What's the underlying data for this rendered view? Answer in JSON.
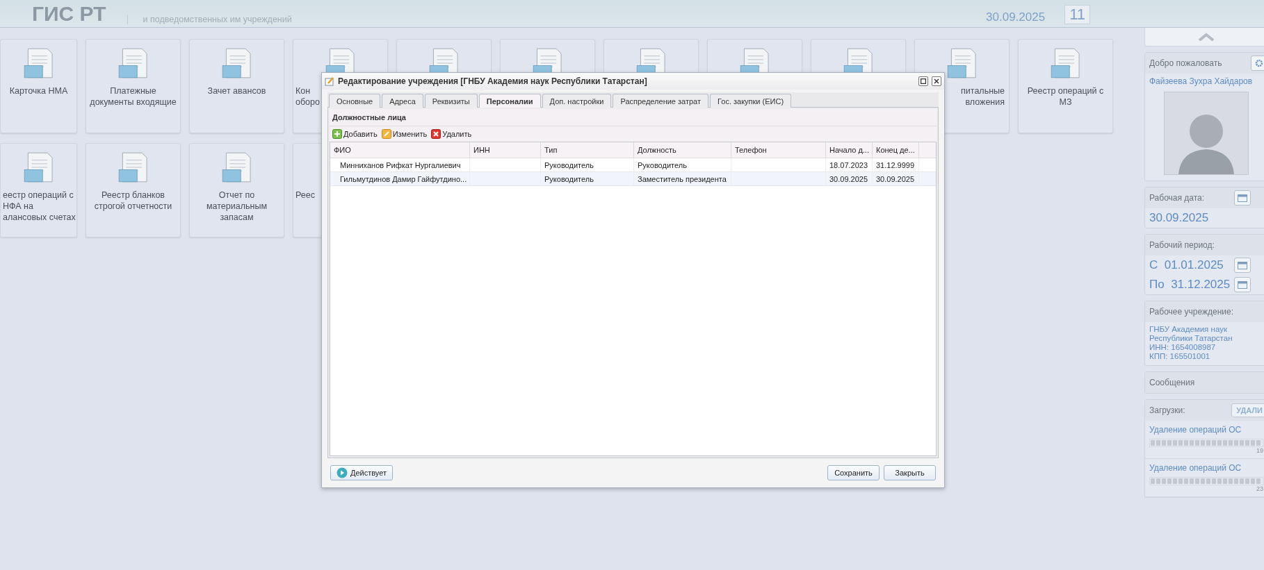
{
  "header": {
    "logo": "ГИС РТ",
    "subtitle": "и подведомственных им учреждений",
    "date": "30.09.2025",
    "clock": "11"
  },
  "tile_rows": [
    [
      {
        "kind": "full",
        "lines": [
          "Карточка НМА"
        ]
      },
      {
        "kind": "full",
        "lines": [
          "Платежные",
          "документы входящие"
        ]
      },
      {
        "kind": "full",
        "lines": [
          "Зачет авансов"
        ]
      },
      {
        "kind": "covered_right",
        "lines": [
          "Кон",
          "оборо"
        ]
      },
      {
        "kind": "covered"
      },
      {
        "kind": "covered"
      },
      {
        "kind": "covered"
      },
      {
        "kind": "covered"
      },
      {
        "kind": "covered"
      },
      {
        "kind": "covered_left",
        "lines": [
          "питальные",
          "вложения"
        ]
      },
      {
        "kind": "full",
        "lines": [
          "Реестр операций с",
          "МЗ"
        ]
      }
    ],
    [
      {
        "kind": "cut_left",
        "lines": [
          "еестр операций с",
          "НФА на",
          "алансовых счетах"
        ]
      },
      {
        "kind": "full",
        "lines": [
          "Реестр бланков",
          "строгой отчетности"
        ]
      },
      {
        "kind": "full",
        "lines": [
          "Отчет по",
          "материальным",
          "запасам"
        ]
      },
      {
        "kind": "covered_right",
        "lines": [
          "Реес"
        ]
      }
    ]
  ],
  "dialog": {
    "title": "Редактирование учреждения [ГНБУ Академия наук Республики Татарстан]",
    "tabs": [
      {
        "label": "Основные",
        "selected": false
      },
      {
        "label": "Адреса",
        "selected": false
      },
      {
        "label": "Реквизиты",
        "selected": false
      },
      {
        "label": "Персоналии",
        "selected": true
      },
      {
        "label": "Доп. настройки",
        "selected": false
      },
      {
        "label": "Распределение затрат",
        "selected": false
      },
      {
        "label": "Гос. закупки (ЕИС)",
        "selected": false
      }
    ],
    "panel_title": "Должностные лица",
    "toolbar": [
      {
        "kind": "add",
        "label": "Добавить"
      },
      {
        "kind": "edit",
        "label": "Изменить"
      },
      {
        "kind": "delete",
        "label": "Удалить"
      }
    ],
    "columns": [
      "ФИО",
      "ИНН",
      "Тип",
      "Должность",
      "Телефон",
      "Начало д...",
      "Конец де..."
    ],
    "rows": [
      [
        "Минниханов Рифкат Нургалиевич",
        "",
        "Руководитель",
        "Руководитель",
        "",
        "18.07.2023",
        "31.12.9999"
      ],
      [
        "Гильмутдинов Дамир Гайфутдино...",
        "",
        "Руководитель",
        "Заместитель президента",
        "",
        "30.09.2025",
        "30.09.2025"
      ]
    ],
    "status_button": "Действует",
    "buttons": [
      "Сохранить",
      "Закрыть"
    ]
  },
  "side": {
    "welcome": "Добро пожаловать",
    "user": "Файзеева Зухра Хайдаров",
    "work_date_label": "Рабочая дата:",
    "work_date": "30.09.2025",
    "period_label": "Рабочий период:",
    "period": [
      {
        "prefix": "С",
        "date": "01.01.2025"
      },
      {
        "prefix": "По",
        "date": "31.12.2025"
      }
    ],
    "org_label": "Рабочее учреждение:",
    "org_lines": [
      "ГНБУ Академия наук",
      "Республики Татарстан",
      "ИНН: 1654008987",
      "КПП: 165501001"
    ],
    "messages": "Сообщения",
    "downloads_label": "Загрузки:",
    "downloads_button": "УДАЛИ",
    "downloads": [
      {
        "name": "Удаление операций ОС",
        "level": 1,
        "time": "19"
      },
      {
        "name": "Удаление операций ОС",
        "level": 1,
        "time": "23"
      }
    ]
  }
}
